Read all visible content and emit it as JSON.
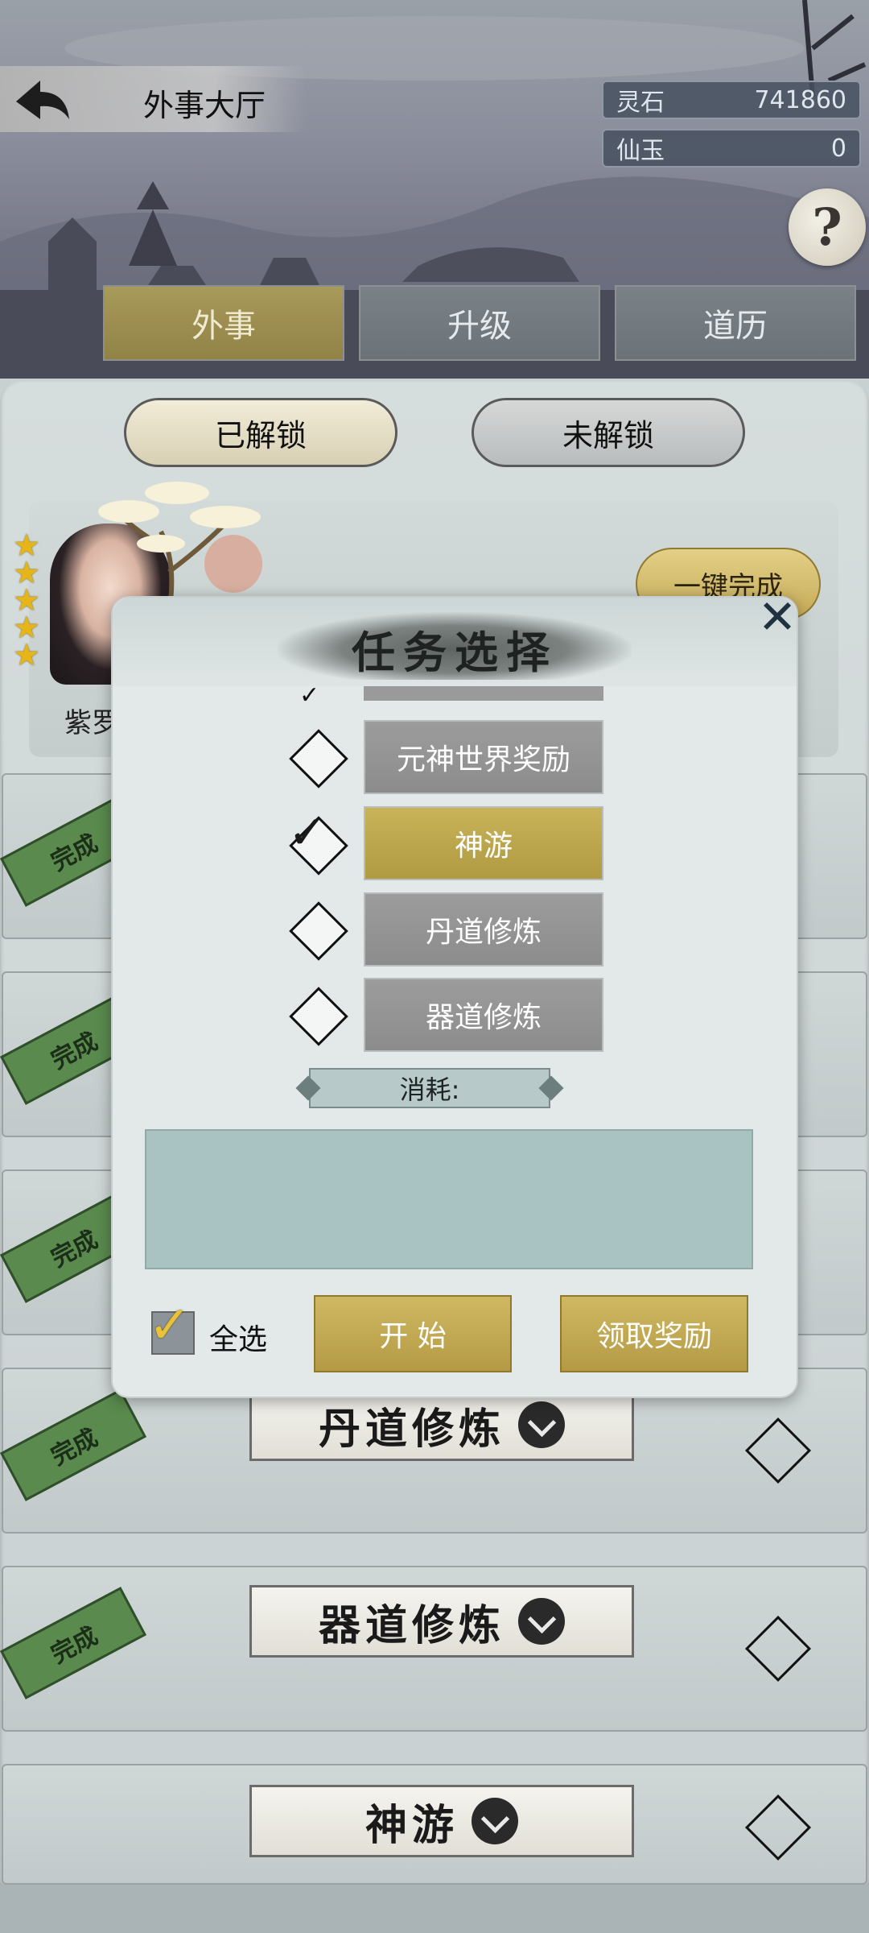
{
  "header": {
    "title": "外事大厅",
    "resources": [
      {
        "name": "灵石",
        "value": "741860"
      },
      {
        "name": "仙玉",
        "value": "0"
      }
    ],
    "help_symbol": "?"
  },
  "tabs": [
    {
      "label": "外事",
      "active": true
    },
    {
      "label": "升级",
      "active": false
    },
    {
      "label": "道历",
      "active": false
    }
  ],
  "subtabs": [
    {
      "label": "已解锁",
      "active": true
    },
    {
      "label": "未解锁",
      "active": false
    }
  ],
  "character": {
    "name": "紫罗",
    "stars": 5,
    "complete_all_label": "一键完成"
  },
  "task_rows": [
    {
      "stamp": "完成",
      "title": ""
    },
    {
      "stamp": "完成",
      "title": ""
    },
    {
      "stamp": "完成",
      "title": ""
    },
    {
      "stamp": "完成",
      "title": "丹道修炼"
    },
    {
      "stamp": "完成",
      "title": "器道修炼"
    },
    {
      "stamp": "",
      "title": "神游"
    }
  ],
  "modal": {
    "title": "任务选择",
    "close_symbol": "✕",
    "options": [
      {
        "label": "元神世界奖励",
        "checked": false
      },
      {
        "label": "神游",
        "checked": true
      },
      {
        "label": "丹道修炼",
        "checked": false
      },
      {
        "label": "器道修炼",
        "checked": false
      }
    ],
    "cost_label": "消耗:",
    "select_all_label": "全选",
    "select_all_checked": true,
    "start_label": "开 始",
    "claim_label": "领取奖励"
  },
  "colors": {
    "gold": "#c2aa52",
    "tab_active": "#a89a5a",
    "stamp_green": "#5a8a4e",
    "cost_box": "#a8c3c1"
  }
}
